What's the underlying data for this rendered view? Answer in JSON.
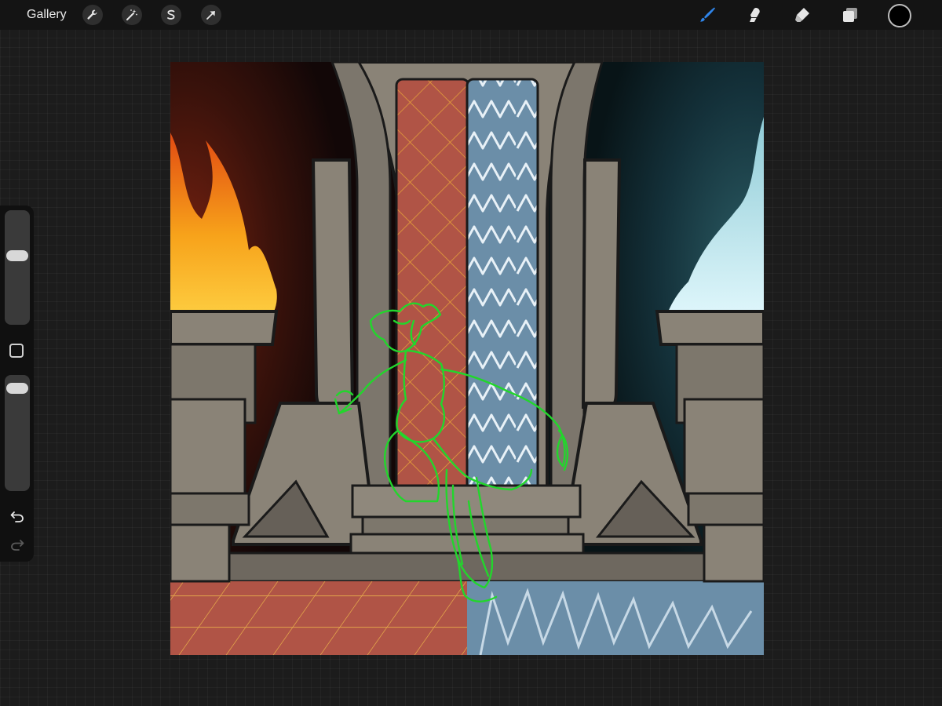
{
  "topbar": {
    "gallery_label": "Gallery",
    "left_tools": [
      {
        "icon": "wrench-icon",
        "name": "actions-button"
      },
      {
        "icon": "magic-wand-icon",
        "name": "adjustments-button"
      },
      {
        "icon": "selection-s-icon",
        "name": "selection-button"
      },
      {
        "icon": "arrow-cursor-icon",
        "name": "transform-button"
      }
    ],
    "right_tools": [
      {
        "icon": "brush-icon",
        "name": "paint-tool-button",
        "active": true
      },
      {
        "icon": "smudge-finger-icon",
        "name": "smudge-tool-button",
        "active": false
      },
      {
        "icon": "eraser-icon",
        "name": "eraser-tool-button",
        "active": false
      },
      {
        "icon": "layers-icon",
        "name": "layers-button",
        "active": false
      }
    ],
    "current_color": "#000000",
    "active_tool_color": "#2f84e8"
  },
  "sidebar": {
    "brush_size_level": 0.62,
    "opacity_level": 0.94,
    "modify_icon": "square-modify-icon",
    "undo_icon": "undo-arrow-icon",
    "redo_icon": "redo-arrow-icon",
    "redo_enabled": false
  },
  "canvas": {
    "subject": "throne-room-illustration",
    "colors": {
      "fire_orange": "#f7a21a",
      "ice_blue": "#bde6ee",
      "banner_red": "#b05446",
      "banner_blue": "#6b8ea8",
      "stone": "#8a8377",
      "sketch_green": "#22d62c"
    }
  }
}
